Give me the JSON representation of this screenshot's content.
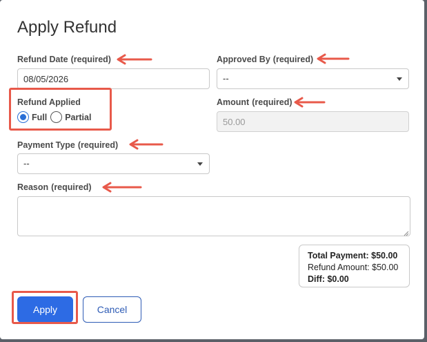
{
  "dialog": {
    "title": "Apply Refund"
  },
  "fields": {
    "refund_date": {
      "label": "Refund Date",
      "required": "(required)",
      "value": "08/05/2026"
    },
    "approved_by": {
      "label": "Approved By",
      "required": "(required)",
      "value": "--"
    },
    "refund_applied": {
      "label": "Refund Applied",
      "options": [
        {
          "label": "Full",
          "checked": true
        },
        {
          "label": "Partial",
          "checked": false
        }
      ]
    },
    "amount": {
      "label": "Amount",
      "required": "(required)",
      "value": "50.00"
    },
    "payment_type": {
      "label": "Payment Type",
      "required": "(required)",
      "value": "--"
    },
    "reason": {
      "label": "Reason",
      "required": "(required)",
      "value": ""
    }
  },
  "summary": {
    "total_payment": "Total Payment: $50.00",
    "refund_amount": "Refund Amount: $50.00",
    "diff": "Diff: $0.00"
  },
  "buttons": {
    "apply": "Apply",
    "cancel": "Cancel"
  },
  "colors": {
    "primary": "#2d6be4",
    "annotation": "#e8594a"
  }
}
